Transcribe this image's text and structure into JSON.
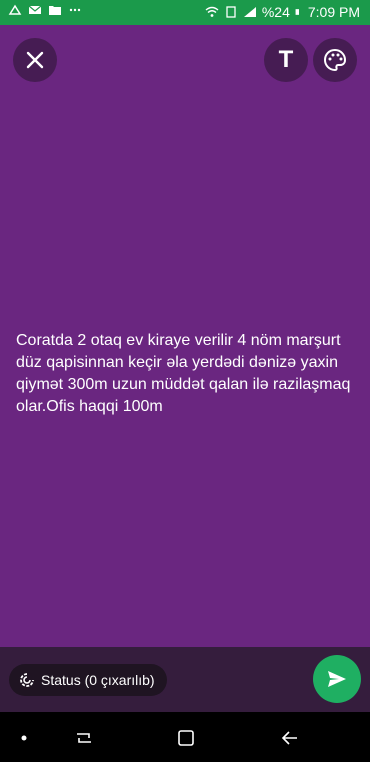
{
  "status_bar": {
    "battery_percent": "%24",
    "time": "7:09 PM"
  },
  "content": {
    "text": "Coratda 2 otaq ev kiraye verilir 4 nöm marşurt düz qapisinnan keçir əla yerdədi dənizə yaxin qiymət 300m uzun müddət qalan ilə razilaşmaq olar.Ofis haqqi 100m"
  },
  "toolbar": {
    "text_tool_label": "T"
  },
  "bottom": {
    "status_chip_label": "Status (0 çıxarılıb)"
  },
  "colors": {
    "background": "#6a2680",
    "status_bar": "#1b9a4b",
    "send_button": "#1faf62",
    "bottom_bar": "#351d3d"
  },
  "icons": [
    "close-icon",
    "text-icon",
    "palette-icon",
    "status-icon",
    "send-icon"
  ]
}
